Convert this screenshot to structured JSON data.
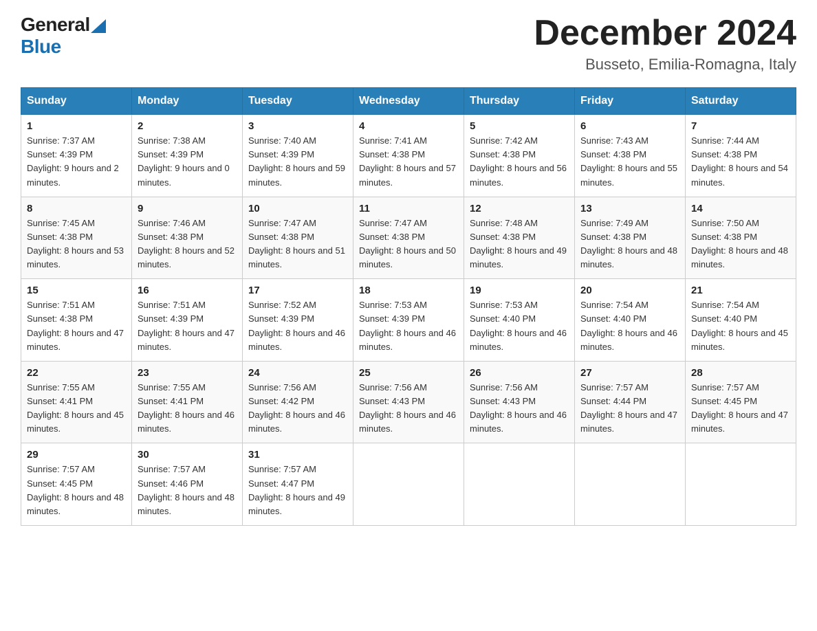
{
  "header": {
    "logo_general": "General",
    "logo_blue": "Blue",
    "month_title": "December 2024",
    "location": "Busseto, Emilia-Romagna, Italy"
  },
  "weekdays": [
    "Sunday",
    "Monday",
    "Tuesday",
    "Wednesday",
    "Thursday",
    "Friday",
    "Saturday"
  ],
  "weeks": [
    [
      {
        "day": "1",
        "sunrise": "7:37 AM",
        "sunset": "4:39 PM",
        "daylight": "9 hours and 2 minutes."
      },
      {
        "day": "2",
        "sunrise": "7:38 AM",
        "sunset": "4:39 PM",
        "daylight": "9 hours and 0 minutes."
      },
      {
        "day": "3",
        "sunrise": "7:40 AM",
        "sunset": "4:39 PM",
        "daylight": "8 hours and 59 minutes."
      },
      {
        "day": "4",
        "sunrise": "7:41 AM",
        "sunset": "4:38 PM",
        "daylight": "8 hours and 57 minutes."
      },
      {
        "day": "5",
        "sunrise": "7:42 AM",
        "sunset": "4:38 PM",
        "daylight": "8 hours and 56 minutes."
      },
      {
        "day": "6",
        "sunrise": "7:43 AM",
        "sunset": "4:38 PM",
        "daylight": "8 hours and 55 minutes."
      },
      {
        "day": "7",
        "sunrise": "7:44 AM",
        "sunset": "4:38 PM",
        "daylight": "8 hours and 54 minutes."
      }
    ],
    [
      {
        "day": "8",
        "sunrise": "7:45 AM",
        "sunset": "4:38 PM",
        "daylight": "8 hours and 53 minutes."
      },
      {
        "day": "9",
        "sunrise": "7:46 AM",
        "sunset": "4:38 PM",
        "daylight": "8 hours and 52 minutes."
      },
      {
        "day": "10",
        "sunrise": "7:47 AM",
        "sunset": "4:38 PM",
        "daylight": "8 hours and 51 minutes."
      },
      {
        "day": "11",
        "sunrise": "7:47 AM",
        "sunset": "4:38 PM",
        "daylight": "8 hours and 50 minutes."
      },
      {
        "day": "12",
        "sunrise": "7:48 AM",
        "sunset": "4:38 PM",
        "daylight": "8 hours and 49 minutes."
      },
      {
        "day": "13",
        "sunrise": "7:49 AM",
        "sunset": "4:38 PM",
        "daylight": "8 hours and 48 minutes."
      },
      {
        "day": "14",
        "sunrise": "7:50 AM",
        "sunset": "4:38 PM",
        "daylight": "8 hours and 48 minutes."
      }
    ],
    [
      {
        "day": "15",
        "sunrise": "7:51 AM",
        "sunset": "4:38 PM",
        "daylight": "8 hours and 47 minutes."
      },
      {
        "day": "16",
        "sunrise": "7:51 AM",
        "sunset": "4:39 PM",
        "daylight": "8 hours and 47 minutes."
      },
      {
        "day": "17",
        "sunrise": "7:52 AM",
        "sunset": "4:39 PM",
        "daylight": "8 hours and 46 minutes."
      },
      {
        "day": "18",
        "sunrise": "7:53 AM",
        "sunset": "4:39 PM",
        "daylight": "8 hours and 46 minutes."
      },
      {
        "day": "19",
        "sunrise": "7:53 AM",
        "sunset": "4:40 PM",
        "daylight": "8 hours and 46 minutes."
      },
      {
        "day": "20",
        "sunrise": "7:54 AM",
        "sunset": "4:40 PM",
        "daylight": "8 hours and 46 minutes."
      },
      {
        "day": "21",
        "sunrise": "7:54 AM",
        "sunset": "4:40 PM",
        "daylight": "8 hours and 45 minutes."
      }
    ],
    [
      {
        "day": "22",
        "sunrise": "7:55 AM",
        "sunset": "4:41 PM",
        "daylight": "8 hours and 45 minutes."
      },
      {
        "day": "23",
        "sunrise": "7:55 AM",
        "sunset": "4:41 PM",
        "daylight": "8 hours and 46 minutes."
      },
      {
        "day": "24",
        "sunrise": "7:56 AM",
        "sunset": "4:42 PM",
        "daylight": "8 hours and 46 minutes."
      },
      {
        "day": "25",
        "sunrise": "7:56 AM",
        "sunset": "4:43 PM",
        "daylight": "8 hours and 46 minutes."
      },
      {
        "day": "26",
        "sunrise": "7:56 AM",
        "sunset": "4:43 PM",
        "daylight": "8 hours and 46 minutes."
      },
      {
        "day": "27",
        "sunrise": "7:57 AM",
        "sunset": "4:44 PM",
        "daylight": "8 hours and 47 minutes."
      },
      {
        "day": "28",
        "sunrise": "7:57 AM",
        "sunset": "4:45 PM",
        "daylight": "8 hours and 47 minutes."
      }
    ],
    [
      {
        "day": "29",
        "sunrise": "7:57 AM",
        "sunset": "4:45 PM",
        "daylight": "8 hours and 48 minutes."
      },
      {
        "day": "30",
        "sunrise": "7:57 AM",
        "sunset": "4:46 PM",
        "daylight": "8 hours and 48 minutes."
      },
      {
        "day": "31",
        "sunrise": "7:57 AM",
        "sunset": "4:47 PM",
        "daylight": "8 hours and 49 minutes."
      },
      null,
      null,
      null,
      null
    ]
  ]
}
